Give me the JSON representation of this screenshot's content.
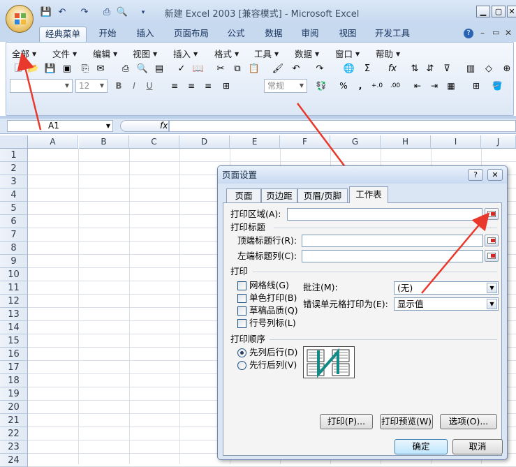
{
  "window": {
    "title": "新建 Excel 2003 [兼容模式] - Microsoft Excel",
    "quick_access": [
      "save-icon",
      "undo-icon",
      "redo-icon",
      "print-icon",
      "print-preview-icon",
      "customize-qat-icon"
    ]
  },
  "ribbon_tabs": [
    "经典菜单",
    "开始",
    "插入",
    "页面布局",
    "公式",
    "数据",
    "审阅",
    "视图",
    "开发工具"
  ],
  "classic_menu": [
    "全部",
    "文件",
    "编辑",
    "视图",
    "插入",
    "格式",
    "工具",
    "数据",
    "窗口",
    "帮助"
  ],
  "toolbar": {
    "font_size": "12",
    "number_format": "常规",
    "sigma": "Σ",
    "fx": "fx",
    "percent": "%",
    "comma": ",",
    "bold": "B",
    "italic": "I",
    "underline": "U"
  },
  "formula_bar": {
    "name_box": "A1",
    "fx_label": "fx",
    "value": ""
  },
  "sheet": {
    "columns": [
      "A",
      "B",
      "C",
      "D",
      "E",
      "F",
      "G",
      "H",
      "I",
      "J"
    ],
    "rows": [
      "1",
      "2",
      "3",
      "4",
      "5",
      "6",
      "7",
      "8",
      "9",
      "10",
      "11",
      "12",
      "13",
      "14",
      "15",
      "16",
      "17",
      "18",
      "19",
      "20",
      "21",
      "22",
      "23",
      "24"
    ]
  },
  "dialog": {
    "title": "页面设置",
    "help": "?",
    "close": "✕",
    "tabs": [
      "页面",
      "页边距",
      "页眉/页脚",
      "工作表"
    ],
    "active_tab": "工作表",
    "print_area_label": "打印区域(A):",
    "print_area_value": "",
    "print_titles_label": "打印标题",
    "top_rows_label": "顶端标题行(R):",
    "top_rows_value": "",
    "left_cols_label": "左端标题列(C):",
    "left_cols_value": "",
    "print_label": "打印",
    "checkboxes": [
      {
        "label": "网格线(G)",
        "checked": false
      },
      {
        "label": "单色打印(B)",
        "checked": false
      },
      {
        "label": "草稿品质(Q)",
        "checked": false
      },
      {
        "label": "行号列标(L)",
        "checked": false
      }
    ],
    "comments_label": "批注(M):",
    "comments_value": "(无)",
    "errors_label": "错误单元格打印为(E):",
    "errors_value": "显示值",
    "page_order_label": "打印顺序",
    "radios": [
      {
        "label": "先列后行(D)",
        "selected": true
      },
      {
        "label": "先行后列(V)",
        "selected": false
      }
    ],
    "buttons": {
      "print": "打印(P)...",
      "preview": "打印预览(W)",
      "options": "选项(O)...",
      "ok": "确定",
      "cancel": "取消"
    }
  },
  "colors": {
    "annotation_arrow": "#e8392c",
    "ribbon_bg": "#dde8f6",
    "dialog_bg": "#dbe6f4",
    "dialog_body": "#f4f4f4"
  }
}
